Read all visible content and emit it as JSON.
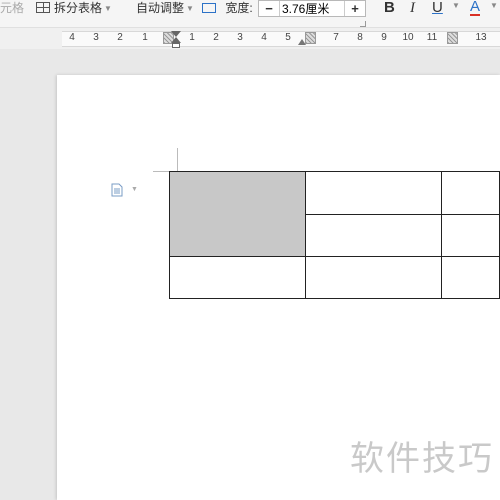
{
  "toolbar": {
    "cell_label_partial": "元格",
    "split_table_label": "拆分表格",
    "autofit_label": "自动调整",
    "width_label": "宽度:",
    "width_value": "3.76厘米",
    "minus_symbol": "−",
    "plus_symbol": "+",
    "bold_label": "B",
    "italic_label": "I",
    "underline_label": "U",
    "font_color_label": "A",
    "font_color_accent": "#d93025",
    "underline_accent": "#2c72c7"
  },
  "ruler": {
    "left_numbers": [
      "4",
      "3",
      "2",
      "1"
    ],
    "right_numbers": [
      "1",
      "2",
      "3",
      "4",
      "5",
      "7",
      "8",
      "9",
      "10",
      "11",
      "13"
    ]
  },
  "table": {
    "shaded_color": "#c8c8c8"
  },
  "watermark": "软件技巧"
}
